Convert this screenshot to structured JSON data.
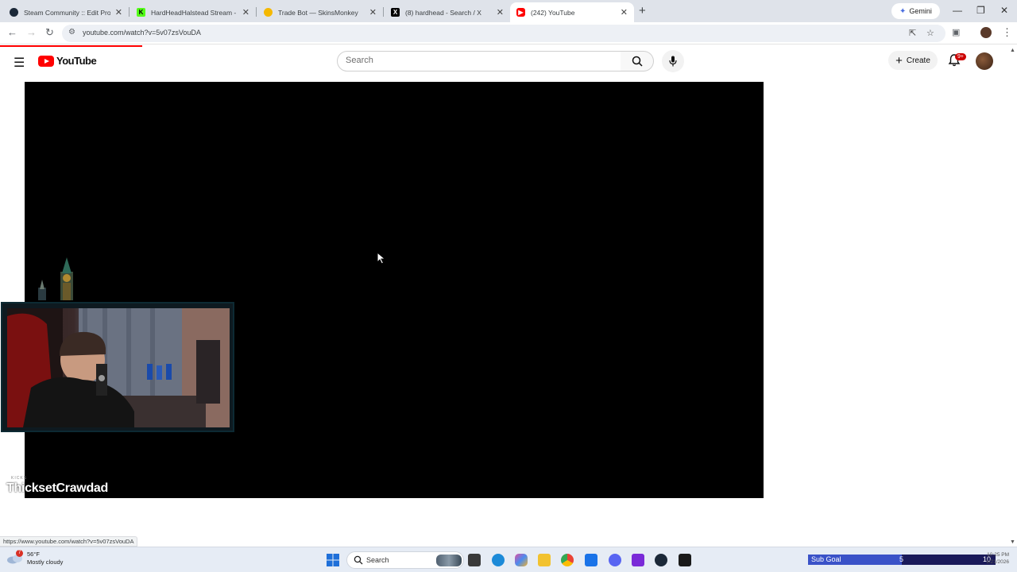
{
  "browser": {
    "tabs": [
      {
        "title": "Steam Community :: Edit Profile",
        "favicon": "steam-icon",
        "color": "#1b2838"
      },
      {
        "title": "HardHeadHalstead Stream - W",
        "favicon": "kick-icon",
        "color": "#53fc18"
      },
      {
        "title": "Trade Bot — SkinsMonkey",
        "favicon": "skinsmonkey-icon",
        "color": "#f5b800"
      },
      {
        "title": "(8) hardhead - Search / X",
        "favicon": "x-icon",
        "color": "#000000"
      },
      {
        "title": "(242) YouTube",
        "favicon": "youtube-icon",
        "color": "#ff0000"
      }
    ],
    "active_tab_index": 4,
    "gemini_label": "Gemini",
    "url": "youtube.com/watch?v=5v07zsVouDA"
  },
  "youtube": {
    "logo_text": "YouTube",
    "search_placeholder": "Search",
    "create_label": "Create",
    "notification_badge": "9+",
    "brand_color": "#ff0000"
  },
  "player": {
    "overlay_name": "ThicksetCrawdad",
    "overlay_tiny": "KICKS"
  },
  "status_bar": {
    "hover_url": "https://www.youtube.com/watch?v=5v07zsVouDA"
  },
  "taskbar": {
    "weather_temp": "56°F",
    "weather_desc": "Mostly cloudy",
    "weather_alert": "7",
    "search_label": "Search",
    "sub_goal": {
      "label": "Sub Goal",
      "current": "5",
      "max": "10",
      "progress": 0.5
    },
    "clock_time": "10:25 PM",
    "clock_date": "1/21/2026"
  }
}
